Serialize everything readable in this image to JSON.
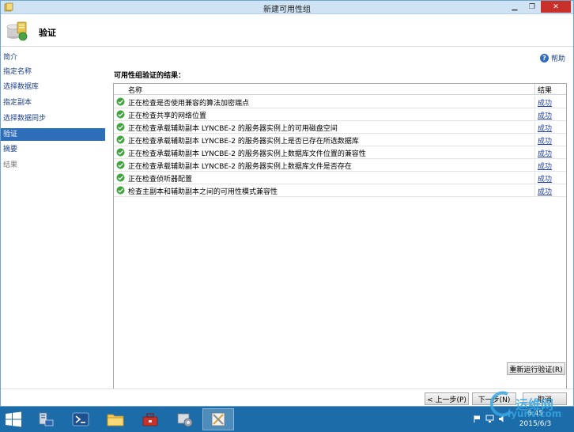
{
  "window": {
    "title": "新建可用性组",
    "page_heading": "验证"
  },
  "sidebar": {
    "items": [
      {
        "label": "简介",
        "state": "normal"
      },
      {
        "label": "指定名称",
        "state": "normal"
      },
      {
        "label": "选择数据库",
        "state": "normal"
      },
      {
        "label": "指定副本",
        "state": "normal"
      },
      {
        "label": "选择数据同步",
        "state": "normal"
      },
      {
        "label": "验证",
        "state": "active"
      },
      {
        "label": "摘要",
        "state": "normal"
      },
      {
        "label": "结果",
        "state": "disabled"
      }
    ]
  },
  "content": {
    "help_label": "帮助",
    "section_title": "可用性组验证的结果：",
    "columns": {
      "name": "名称",
      "result": "结果"
    },
    "rows": [
      {
        "name": "正在检查是否使用兼容的算法加密端点",
        "result": "成功"
      },
      {
        "name": "正在检查共享的网络位置",
        "result": "成功"
      },
      {
        "name": "正在检查承载辅助副本 LYNCBE-2 的服务器实例上的可用磁盘空间",
        "result": "成功"
      },
      {
        "name": "正在检查承载辅助副本 LYNCBE-2 的服务器实例上是否已存在所选数据库",
        "result": "成功"
      },
      {
        "name": "正在检查承载辅助副本 LYNCBE-2 的服务器实例上数据库文件位置的兼容性",
        "result": "成功"
      },
      {
        "name": "正在检查承载辅助副本 LYNCBE-2 的服务器实例上数据库文件是否存在",
        "result": "成功"
      },
      {
        "name": "正在检查侦听器配置",
        "result": "成功"
      },
      {
        "name": "检查主副本和辅助副本之间的可用性模式兼容性",
        "result": "成功"
      }
    ],
    "rerun_label": "重新运行验证(R)"
  },
  "footer": {
    "prev_label": "< 上一步(P)",
    "next_label": "下一步(N)",
    "cancel_label": "取消"
  },
  "taskbar": {
    "time": "6:45",
    "date": "2015/6/3",
    "apps": [
      "server-manager-icon",
      "powershell-icon",
      "file-explorer-icon",
      "toolbox-icon",
      "services-icon",
      "sql-tools-icon"
    ]
  },
  "watermark": {
    "cn": "运维网",
    "url": "iyunv.com"
  },
  "colors": {
    "accent": "#2e6db8",
    "taskbar": "#1b6ca8",
    "success": "#3fa23a",
    "link": "#1c3ba8"
  }
}
